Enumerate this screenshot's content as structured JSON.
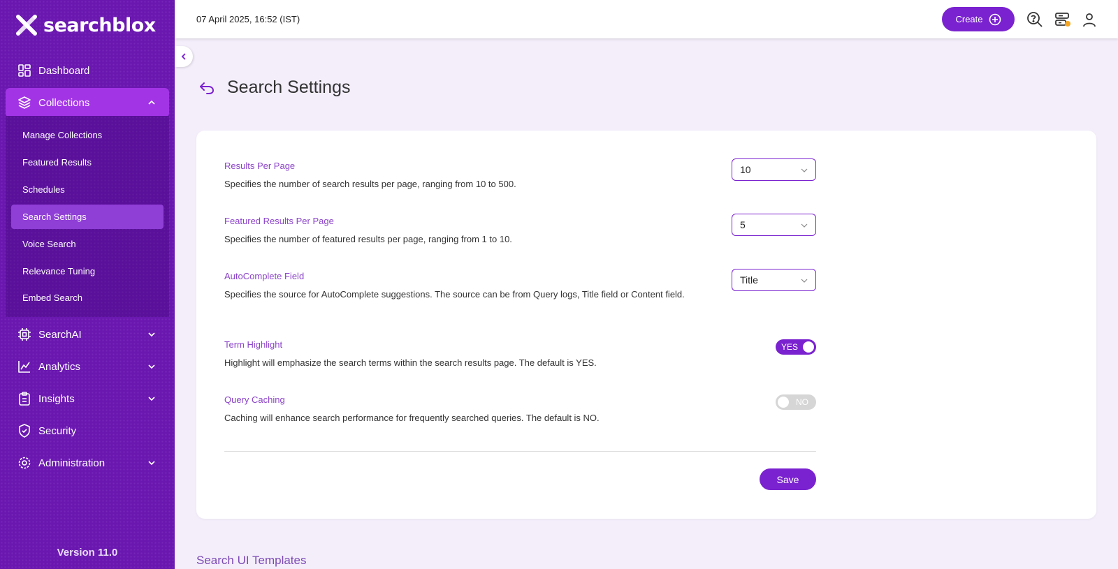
{
  "brand": {
    "name": "searchblox"
  },
  "sidebar": {
    "items": [
      {
        "label": "Dashboard",
        "icon": "dashboard-icon"
      },
      {
        "label": "Collections",
        "icon": "layers-icon",
        "expanded": true
      },
      {
        "label": "SearchAI",
        "icon": "cpu-icon"
      },
      {
        "label": "Analytics",
        "icon": "analytics-icon"
      },
      {
        "label": "Insights",
        "icon": "clipboard-icon"
      },
      {
        "label": "Security",
        "icon": "shield-icon"
      },
      {
        "label": "Administration",
        "icon": "gear-icon"
      }
    ],
    "submenu": [
      {
        "label": "Manage Collections"
      },
      {
        "label": "Featured Results"
      },
      {
        "label": "Schedules"
      },
      {
        "label": "Search Settings",
        "active": true
      },
      {
        "label": "Voice Search"
      },
      {
        "label": "Relevance Tuning"
      },
      {
        "label": "Embed Search"
      }
    ],
    "version": "Version 11.0"
  },
  "topbar": {
    "datetime": "07 April 2025, 16:52 (IST)",
    "create_label": "Create"
  },
  "page": {
    "title": "Search Settings"
  },
  "settings": [
    {
      "label": "Results Per Page",
      "desc": "Specifies the number of search results per page, ranging from 10 to 500.",
      "value": "10"
    },
    {
      "label": "Featured Results Per Page",
      "desc": "Specifies the number of featured results per page, ranging from 1 to 10.",
      "value": "5"
    },
    {
      "label": "AutoComplete Field",
      "desc": "Specifies the source for AutoComplete suggestions. The source can be from Query logs, Title field or Content field.",
      "value": "Title"
    },
    {
      "label": "Term Highlight",
      "desc": "Highlight will emphasize the search terms within the search results page. The default is YES.",
      "value": "YES"
    },
    {
      "label": "Query Caching",
      "desc": "Caching will enhance search performance for frequently searched queries. The default is NO.",
      "value": "NO"
    }
  ],
  "save_label": "Save",
  "next_section": "Search UI Templates",
  "colors": {
    "primary": "#7a22cf",
    "sidebar": "#6a17b0",
    "accent_label": "#8c44c9",
    "background": "#f4eefb",
    "notification_dot": "#f5a623"
  }
}
